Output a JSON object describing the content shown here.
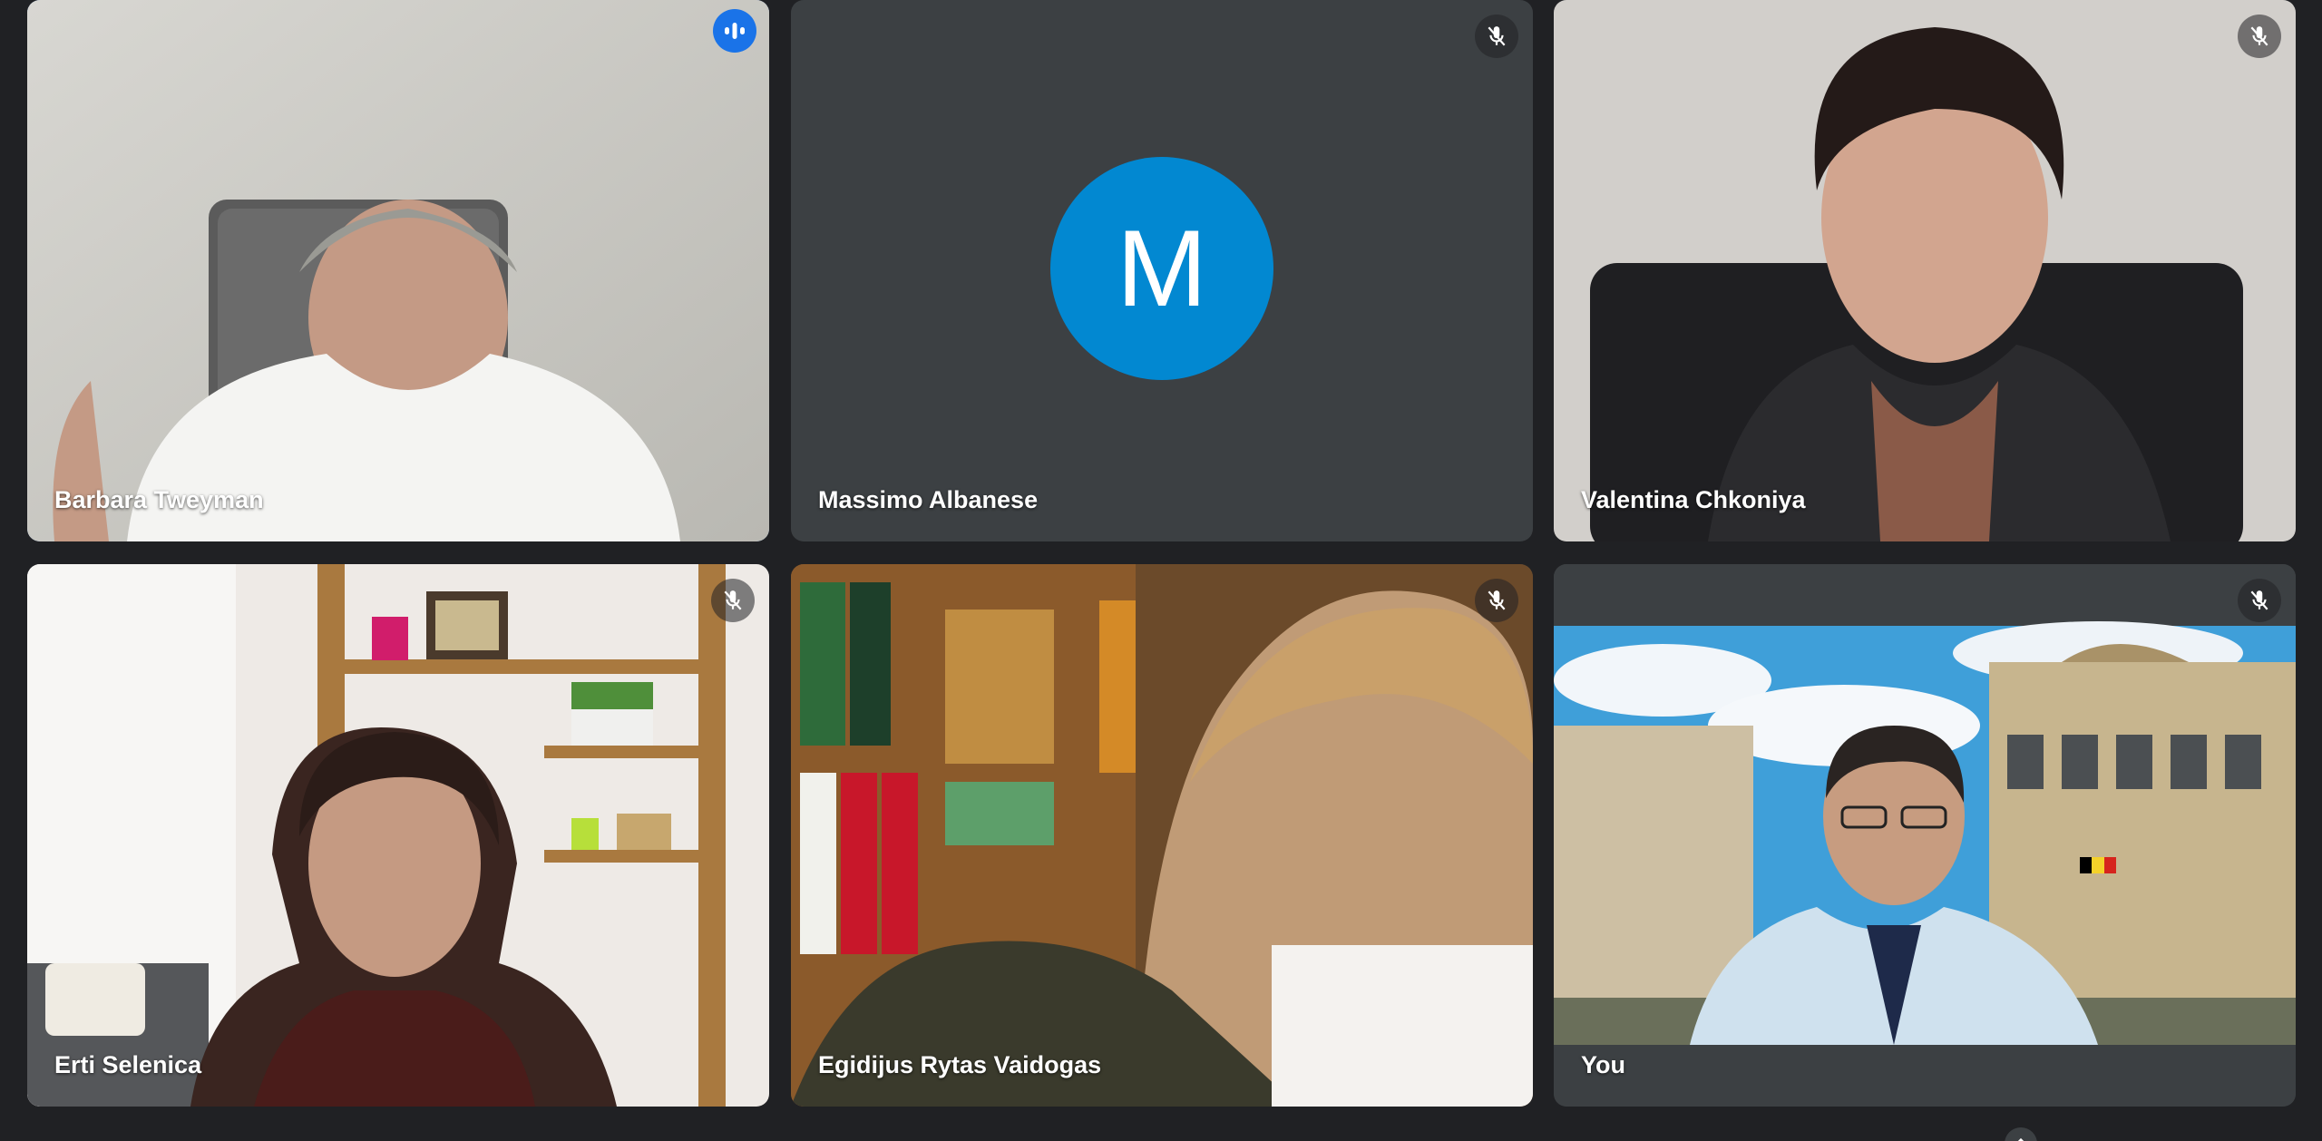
{
  "meeting": {
    "tiles": [
      {
        "name": "Barbara Tweyman",
        "state": "speaking"
      },
      {
        "name": "Massimo Albanese",
        "state": "muted",
        "avatar_letter": "M"
      },
      {
        "name": "Valentina Chkoniya",
        "state": "muted"
      },
      {
        "name": "Erti Selenica",
        "state": "muted"
      },
      {
        "name": "Egidijus Rytas Vaidogas",
        "state": "muted"
      },
      {
        "name": "You",
        "state": "muted"
      }
    ],
    "colors": {
      "background": "#202124",
      "tile_background": "#3c4043",
      "speaking_border": "#8ab4f8",
      "speaking_badge": "#1a73e8",
      "avatar": "#0288d1"
    }
  },
  "icons": {
    "speaking": "audio-level-icon",
    "muted": "mic-off-icon",
    "chevron": "chevron-up-icon"
  }
}
